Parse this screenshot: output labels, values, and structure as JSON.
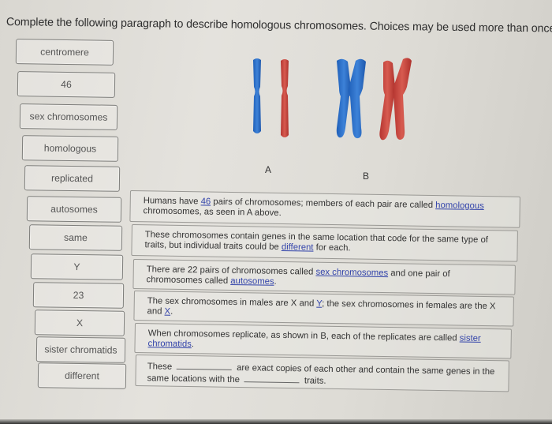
{
  "instruction": "Complete the following paragraph to describe homologous chromosomes. Choices may be used more than once.",
  "choices": [
    {
      "label": "centromere"
    },
    {
      "label": "46"
    },
    {
      "label": "sex chromosomes"
    },
    {
      "label": "homologous"
    },
    {
      "label": "replicated"
    },
    {
      "label": "autosomes"
    },
    {
      "label": "same"
    },
    {
      "label": "Y"
    },
    {
      "label": "23"
    },
    {
      "label": "X"
    },
    {
      "label": "sister chromatids"
    },
    {
      "label": "different"
    }
  ],
  "figure": {
    "label_a": "A",
    "label_b": "B",
    "colors": {
      "blue": "#2f6fc6",
      "red": "#c8423a"
    }
  },
  "sentences": [
    {
      "p1": "Humans have ",
      "f1": "46",
      "p2": " pairs of chromosomes; members of each pair are called ",
      "f2": "homologous",
      "p3": " chromosomes, as seen in A above."
    },
    {
      "p1": "These chromosomes contain genes in the same location that code for the same type of traits, but individual traits could be ",
      "f1": "different",
      "p2": " for each."
    },
    {
      "p1": "There are 22 pairs of chromosomes called ",
      "f1": "sex chromosomes",
      "p2": " and one pair of chromosomes called ",
      "f2": "autosomes",
      "p3": "."
    },
    {
      "p1": "The sex chromosomes in males are X and ",
      "f1": "Y",
      "p2": "; the sex chromosomes in females are the X and ",
      "f2": "X",
      "p3": "."
    },
    {
      "p1": "When chromosomes replicate, as shown in B, each of the replicates are called ",
      "f1": "sister chromatids",
      "p2": "."
    },
    {
      "p1": "These",
      "p2": "are exact copies of each other and contain the same genes in the same locations with the",
      "p3": "traits."
    }
  ],
  "colors": {
    "link": "#3344aa",
    "border": "#7d7d7a"
  }
}
